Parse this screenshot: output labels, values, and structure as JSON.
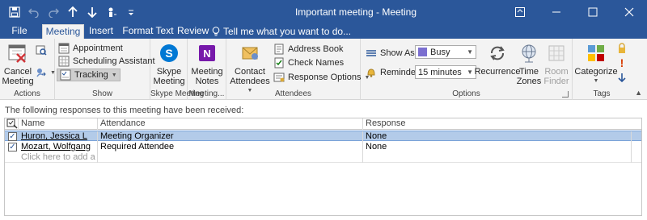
{
  "window": {
    "title": "Important meeting  -  Meeting",
    "controls": [
      "ribbon-display-icon",
      "minimize-icon",
      "maximize-icon",
      "close-icon"
    ]
  },
  "qat": [
    "save-icon",
    "undo-icon",
    "redo-icon",
    "up-arrow-icon",
    "down-arrow-icon",
    "touch-mode-icon",
    "customize-icon"
  ],
  "tabs": [
    {
      "label": "File"
    },
    {
      "label": "Meeting"
    },
    {
      "label": "Insert"
    },
    {
      "label": "Format Text"
    },
    {
      "label": "Review"
    }
  ],
  "tell_me": "Tell me what you want to do...",
  "ribbon": {
    "actions": {
      "label": "Actions",
      "cancel": "Cancel\nMeeting"
    },
    "show": {
      "label": "Show",
      "appointment": "Appointment",
      "scheduling": "Scheduling Assistant",
      "tracking": "Tracking"
    },
    "skype": {
      "label": "Skype Meeting",
      "button": "Skype\nMeeting"
    },
    "meeting_notes": {
      "label": "Meeting...",
      "button": "Meeting\nNotes"
    },
    "attendees": {
      "label": "Attendees",
      "contact": "Contact\nAttendees",
      "address_book": "Address Book",
      "check_names": "Check Names",
      "response_options": "Response Options"
    },
    "options": {
      "label": "Options",
      "show_as_label": "Show As:",
      "show_as_value": "Busy",
      "reminder_label": "Reminder:",
      "reminder_value": "15 minutes",
      "recurrence": "Recurrence",
      "time_zones": "Time\nZones",
      "room_finder": "Room\nFinder"
    },
    "tags": {
      "label": "Tags",
      "categorize": "Categorize"
    }
  },
  "content": {
    "info_text": "The following responses to this meeting have been received:",
    "columns": {
      "name": "Name",
      "attendance": "Attendance",
      "response": "Response"
    },
    "rows": [
      {
        "name": "Huron, Jessica L",
        "attendance": "Meeting Organizer",
        "response": "None",
        "checked": true,
        "selected": true
      },
      {
        "name": "Mozart, Wolfgang",
        "attendance": "Required Attendee",
        "response": "None",
        "checked": true,
        "selected": false
      }
    ],
    "add_placeholder": "Click here to add a name"
  },
  "colors": {
    "title_bar": "#2b579a",
    "ribbon_bg": "#f3f3f3",
    "selection": "#b3cbe9",
    "busy": "#7b6fd0",
    "high_importance": "#d83b01",
    "low_importance": "#2b579a"
  }
}
